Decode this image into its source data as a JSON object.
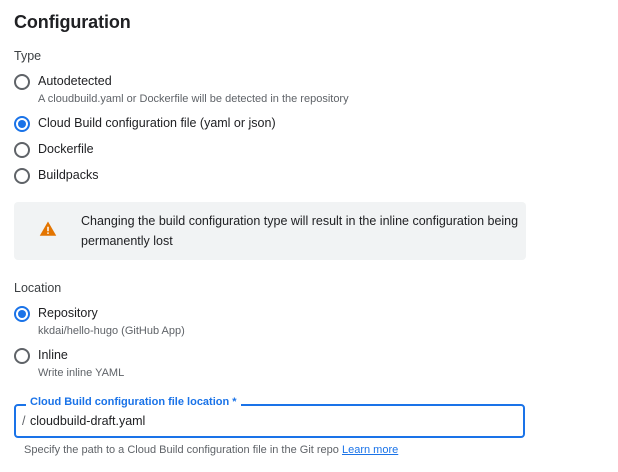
{
  "page": {
    "title": "Configuration"
  },
  "type_section": {
    "label": "Type",
    "options": [
      {
        "label": "Autodetected",
        "sublabel": "A cloudbuild.yaml or Dockerfile will be detected in the repository",
        "checked": false
      },
      {
        "label": "Cloud Build configuration file (yaml or json)",
        "checked": true
      },
      {
        "label": "Dockerfile",
        "checked": false
      },
      {
        "label": "Buildpacks",
        "checked": false
      }
    ]
  },
  "warning": {
    "icon": "warning-triangle-icon",
    "color": "#e37400",
    "text": "Changing the build configuration type will result in the inline configuration being permanently lost"
  },
  "location_section": {
    "label": "Location",
    "options": [
      {
        "label": "Repository",
        "sublabel": "kkdai/hello-hugo (GitHub App)",
        "checked": true
      },
      {
        "label": "Inline",
        "sublabel": "Write inline YAML",
        "checked": false
      }
    ]
  },
  "config_file": {
    "legend": "Cloud Build configuration file location *",
    "prefix": "/",
    "value": "cloudbuild-draft.yaml",
    "hint": "Specify the path to a Cloud Build configuration file in the Git repo",
    "link": "Learn more"
  },
  "colors": {
    "accent": "#1a73e8",
    "banner_bg": "#f1f3f4",
    "text": "#202124",
    "secondary": "#5f6368"
  }
}
